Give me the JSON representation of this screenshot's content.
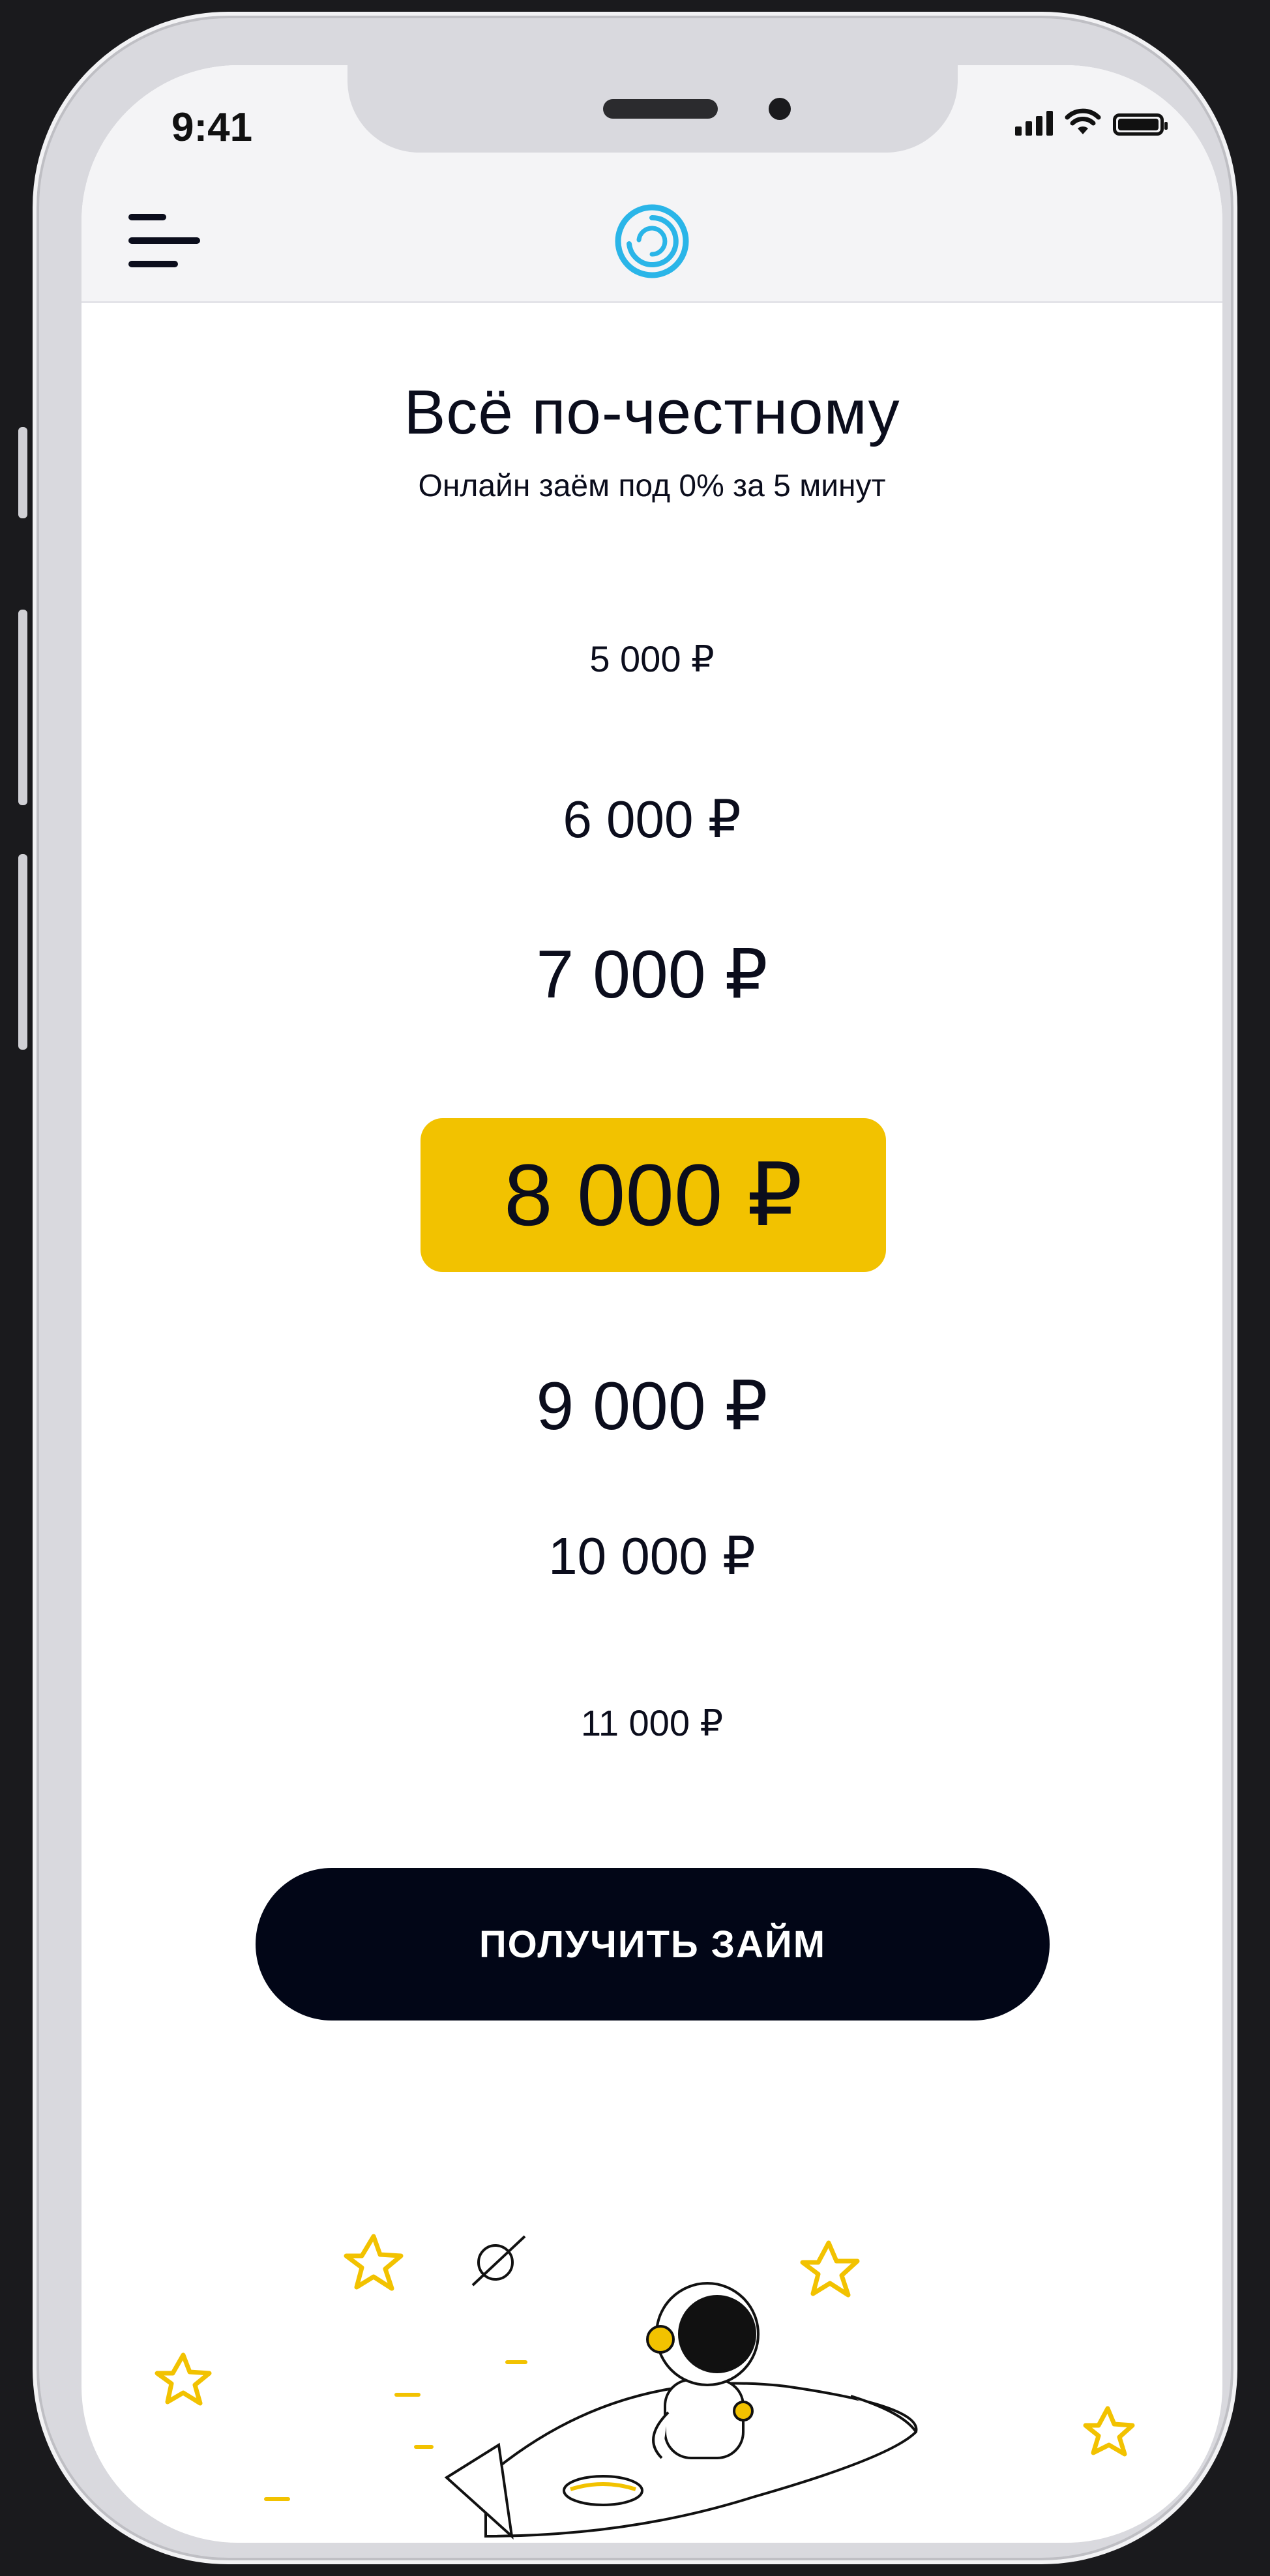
{
  "status_bar": {
    "time": "9:41"
  },
  "header": {
    "menu_icon": "hamburger-menu-icon",
    "logo_icon": "ring-logo-icon"
  },
  "main": {
    "title": "Всё по-честному",
    "subtitle": "Онлайн заём под 0% за 5 минут",
    "amount_picker": {
      "options": [
        "5 000 ₽",
        "6 000 ₽",
        "7 000 ₽",
        "8 000 ₽",
        "9 000 ₽",
        "10 000 ₽",
        "11 000 ₽"
      ],
      "selected": "8 000 ₽"
    },
    "cta_label": "ПОЛУЧИТЬ ЗАЙМ"
  },
  "colors": {
    "accent": "#f2c200",
    "button": "#020617",
    "text": "#0b0d1c",
    "logo": "#2ab5e8"
  }
}
